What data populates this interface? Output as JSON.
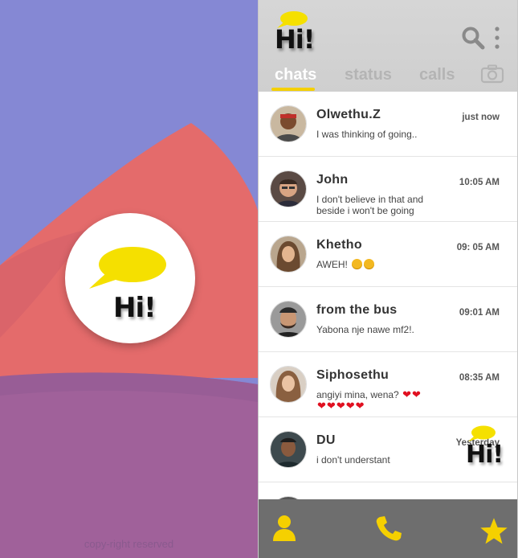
{
  "splash": {
    "logo_text": "Hi!",
    "copyright": "copy-right reserved",
    "colors": {
      "background": "#8588d4",
      "coral": "#e46b6b",
      "plum": "#a0619a",
      "bubble": "#f5e000"
    }
  },
  "header": {
    "title": "Hi!",
    "tabs": [
      {
        "label": "chats",
        "active": true
      },
      {
        "label": "status",
        "active": false
      },
      {
        "label": "calls",
        "active": false
      }
    ],
    "icons": [
      "search-icon",
      "more-vert-icon",
      "camera-icon"
    ]
  },
  "chats": [
    {
      "name": "Olwethu.Z",
      "message": "I was thinking of going..",
      "time": "just now"
    },
    {
      "name": "John",
      "message": "I don't believe in that and beside i won't be going",
      "time": "10:05 AM"
    },
    {
      "name": "Khetho",
      "message": "AWEH!",
      "time": "09: 05 AM",
      "emoji": "grinning-faces"
    },
    {
      "name": "from the bus",
      "message": "Yabona nje nawe mf2!.",
      "time": "09:01 AM"
    },
    {
      "name": "Siphosethu",
      "message": "angiyi mina, wena?",
      "time": "08:35 AM",
      "emoji": "hearts"
    },
    {
      "name": "DU",
      "message": "i don't understant",
      "time": "Yesterday"
    }
  ],
  "fab": {
    "text": "Hi!"
  },
  "bottom_nav": {
    "icons": [
      "contacts-icon",
      "phone-icon",
      "star-icon"
    ],
    "color": "#f5d000"
  }
}
